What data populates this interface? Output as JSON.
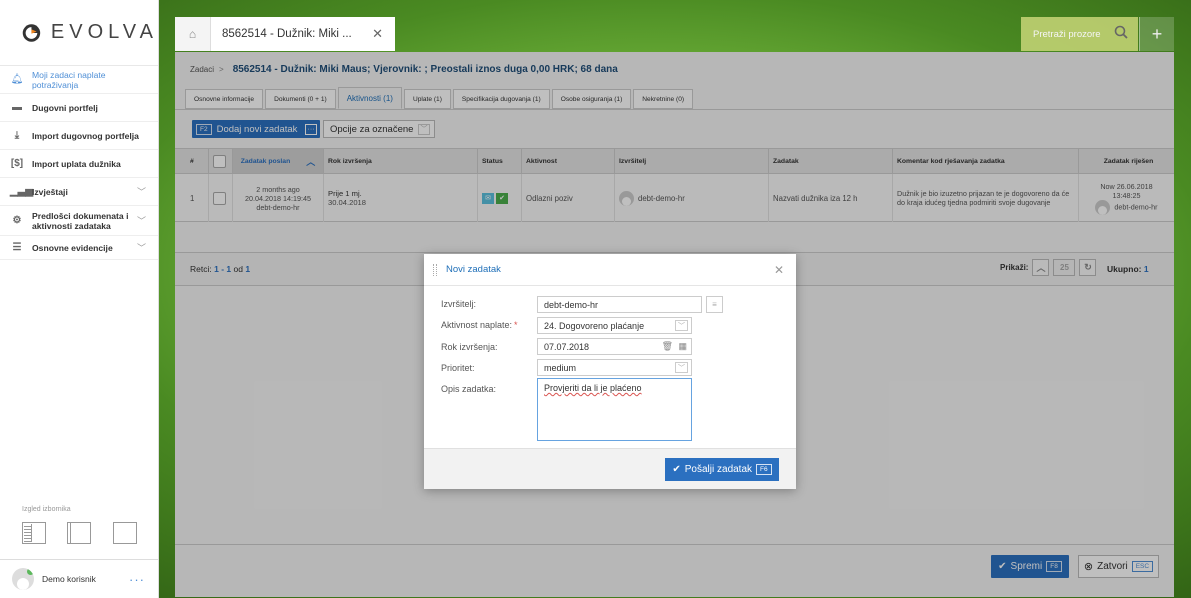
{
  "app": {
    "logo_text": "EVOLVA"
  },
  "sidebar": {
    "items": [
      {
        "label": "Moji zadaci naplate potraživanja",
        "icon": "bell-icon"
      },
      {
        "label": "Dugovni portfelj",
        "icon": "briefcase-icon"
      },
      {
        "label": "Import dugovnog portfelja",
        "icon": "import-icon"
      },
      {
        "label": "Import uplata dužnika",
        "icon": "money-icon"
      },
      {
        "label": "Izvještaji",
        "icon": "bar-chart-icon"
      },
      {
        "label": "Predlošci dokumenata i aktivnosti zadataka",
        "icon": "gear-icon"
      },
      {
        "label": "Osnovne evidencije",
        "icon": "list-icon"
      }
    ],
    "layout_label": "Izgled izbornika",
    "user_name": "Demo korisnik"
  },
  "topbar": {
    "tab_title": "8562514 - Dužnik: Miki ...",
    "search_placeholder": "Pretraži prozore"
  },
  "breadcrumb": {
    "root": "Zadaci",
    "title": "8562514 - Dužnik: Miki Maus; Vjerovnik: ; Preostali iznos duga 0,00 HRK; 68 dana"
  },
  "subtabs": [
    "Osnovne informacije",
    "Dokumenti (0 + 1)",
    "Aktivnosti (1)",
    "Uplate (1)",
    "Specifikacija dugovanja (1)",
    "Osobe osiguranja (1)",
    "Nekretnine (0)"
  ],
  "toolbar": {
    "add_key": "F2",
    "add_label": "Dodaj novi zadatak",
    "options_label": "Opcije za označene"
  },
  "table": {
    "headers": [
      "#",
      "Zadatak poslan",
      "Rok izvršenja",
      "Status",
      "Aktivnost",
      "Izvršitelj",
      "Zadatak",
      "Komentar kod rješavanja zadatka",
      "Zadatak riješen"
    ],
    "row": {
      "num": "1",
      "sent_ago": "2 months ago",
      "sent_date": "20.04.2018 14:19:45",
      "sent_by": "debt-demo-hr",
      "due_rel": "Prije 1 mj.",
      "due_date": "30.04.2018",
      "activity": "Odlazni poziv",
      "executor": "debt-demo-hr",
      "task": "Nazvati dužnika iza 12 h",
      "comment": "Dužnik je bio izuzetno prijazan te je dogovoreno da će do kraja idućeg tjedna podmiriti svoje dugovanje",
      "solved_date": "Now 26.06.2018",
      "solved_time": "13:48:25",
      "solved_by": "debt-demo-hr"
    }
  },
  "footer": {
    "records_label": "Retci:",
    "records_range": "1 - 1",
    "records_of": "od",
    "records_total": "1",
    "show_label": "Prikaži:",
    "page_size": "25",
    "total_label": "Ukupno:",
    "total_value": "1"
  },
  "actions": {
    "save_label": "Spremi",
    "save_key": "F8",
    "close_label": "Zatvori",
    "close_key": "ESC"
  },
  "modal": {
    "title": "Novi zadatak",
    "fields": {
      "executor_label": "Izvršitelj:",
      "executor_value": "debt-demo-hr",
      "activity_label": "Aktivnost naplate:",
      "activity_value": "24. Dogovoreno plaćanje",
      "due_label": "Rok izvršenja:",
      "due_value": "07.07.2018",
      "priority_label": "Prioritet:",
      "priority_value": "medium",
      "desc_label": "Opis zadatka:",
      "desc_value": "Provjeriti da li je plaćeno"
    },
    "send_label": "Pošalji zadatak",
    "send_key": "F6"
  }
}
